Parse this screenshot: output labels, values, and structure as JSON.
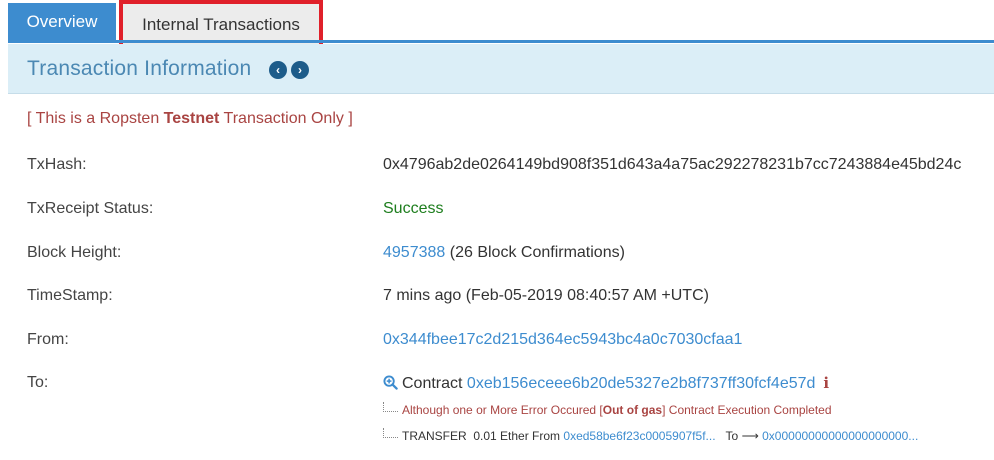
{
  "tabs": {
    "overview": "Overview",
    "internal": "Internal Transactions"
  },
  "panel": {
    "title": "Transaction Information"
  },
  "notice": {
    "prefix": "[ This is a Ropsten ",
    "bold": "Testnet",
    "suffix": " Transaction Only ]"
  },
  "rows": {
    "txhash": {
      "label": "TxHash:",
      "value": "0x4796ab2de0264149bd908f351d643a4a75ac292278231b7cc7243884e45bd24c"
    },
    "status": {
      "label": "TxReceipt Status:",
      "value": "Success"
    },
    "block": {
      "label": "Block Height:",
      "value": "4957388",
      "extra": "(26 Block Confirmations)"
    },
    "timestamp": {
      "label": "TimeStamp:",
      "value": "7 mins ago (Feb-05-2019 08:40:57 AM +UTC)"
    },
    "from": {
      "label": "From:",
      "value": "0x344fbee17c2d215d364ec5943bc4a0c7030cfaa1"
    },
    "to": {
      "label": "To:",
      "contract_word": "Contract",
      "contract_address": "0xeb156eceee6b20de5327e2b8f737ff30fcf4e57d",
      "error_prefix": "Although one or More Error Occured [",
      "error_bold": "Out of gas",
      "error_suffix": "] Contract Execution Completed",
      "transfer_prefix": "TRANSFER",
      "transfer_amount": "0.01 Ether From",
      "transfer_from": "0xed58be6f23c0005907f5f...",
      "transfer_to_label": "To",
      "transfer_to": "0x00000000000000000000..."
    }
  },
  "colors": {
    "accent": "#3d8ccf",
    "highlight_border": "#e0202a",
    "success": "#1e7e1e",
    "warning": "#a94442",
    "header_bg": "#dbeef7"
  }
}
